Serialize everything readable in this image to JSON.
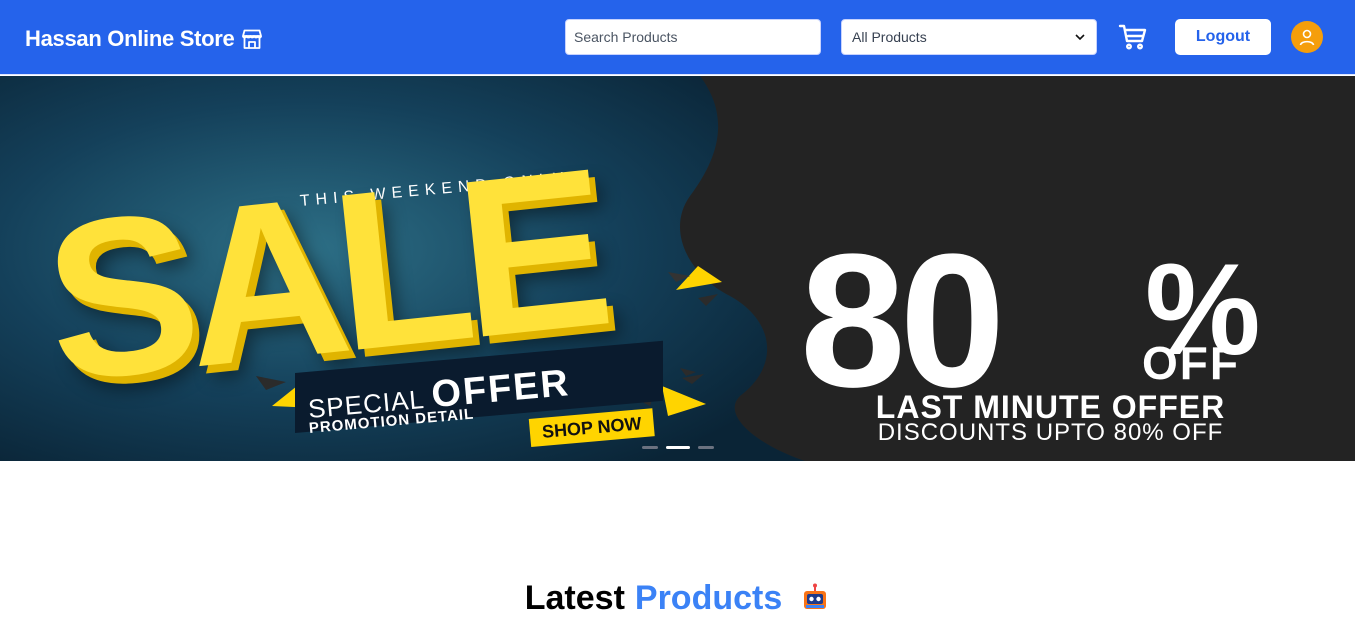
{
  "navbar": {
    "brand": "Hassan Online Store",
    "brand_icon": "store-icon",
    "search_placeholder": "Search Products",
    "category_selected": "All Products",
    "cart_icon": "cart-icon",
    "logout_label": "Logout",
    "avatar_icon": "user-icon",
    "bg_color": "#2563eb",
    "avatar_color": "#f59e0b"
  },
  "banner": {
    "weekend": "THIS WEEKEND ONLY",
    "sale": "SALE",
    "special": "SPECIAL",
    "offer": "OFFER",
    "promotion": "PROMOTION DETAIL",
    "shop_now": "SHOP NOW",
    "eighty": "80",
    "percent": "%",
    "off": "OFF",
    "last_minute": "LAST MINUTE OFFER",
    "discounts": "DISCOUNTS UPTO 80% OFF",
    "slide_count": 3,
    "active_slide": 2,
    "accent_color": "#ffe23a"
  },
  "section": {
    "title_part1": "Latest",
    "title_part2": "Products",
    "title_icon": "robot-icon"
  }
}
